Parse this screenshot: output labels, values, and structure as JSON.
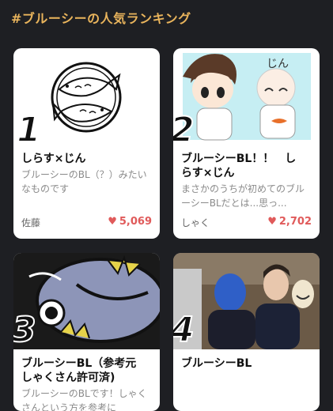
{
  "header": {
    "title": "#ブルーシーの人気ランキング"
  },
  "cards": [
    {
      "rank": "1",
      "title": "しらす×じん",
      "desc": "ブルーシーのBL（？）みたいなものです",
      "author": "佐藤",
      "likes": "5,069"
    },
    {
      "rank": "2",
      "title_line1": "ブルーシーBL！！　し",
      "title_line2": "らす×じん",
      "desc": "まさかのうちが初めてのブルーシーBLだとは...思っ...",
      "author": "しゃく",
      "likes": "2,702",
      "thumb_label": "じん"
    },
    {
      "rank": "3",
      "title_line1": "ブルーシーBL（参考元",
      "title_line2": "しゃくさん許可済)",
      "desc": "ブルーシーのBLです！しゃくさんという方を参考に"
    },
    {
      "rank": "4",
      "title": "ブルーシーBL"
    }
  ],
  "colors": {
    "accent": "#e9b45c",
    "background": "#1e1f23",
    "heart": "#e05a5a"
  }
}
